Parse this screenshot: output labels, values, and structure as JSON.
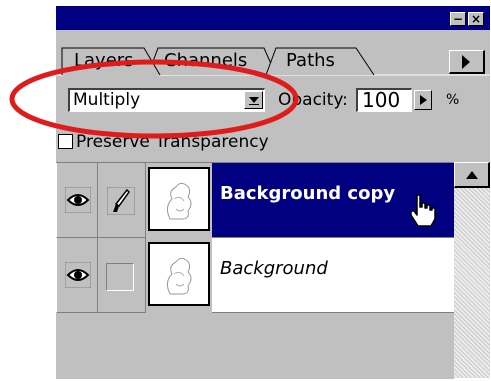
{
  "tabs": [
    {
      "label": "Layers",
      "active": true
    },
    {
      "label": "Channels",
      "active": false
    },
    {
      "label": "Paths",
      "active": false
    }
  ],
  "blend_mode": {
    "value": "Multiply"
  },
  "opacity": {
    "label": "Opacity:",
    "value": "100",
    "unit": "%"
  },
  "preserve_transparency": {
    "label": "Preserve Transparency",
    "checked": false
  },
  "layers": [
    {
      "name": "Background copy",
      "selected": true,
      "visible": true,
      "brush": true
    },
    {
      "name": "Background",
      "selected": false,
      "visible": true,
      "brush": false
    }
  ],
  "title_buttons": {
    "minimize": "−",
    "close": "×"
  },
  "colors": {
    "titlebar": "#000080",
    "selection": "#000080",
    "panel": "#c0c0c0",
    "annotation": "#e01b1b"
  },
  "icons": [
    "minimize-icon",
    "close-icon",
    "tab-scroll-icon",
    "dropdown-arrow-icon",
    "eye-icon",
    "brush-icon",
    "hand-cursor-icon",
    "scroll-up-icon"
  ]
}
